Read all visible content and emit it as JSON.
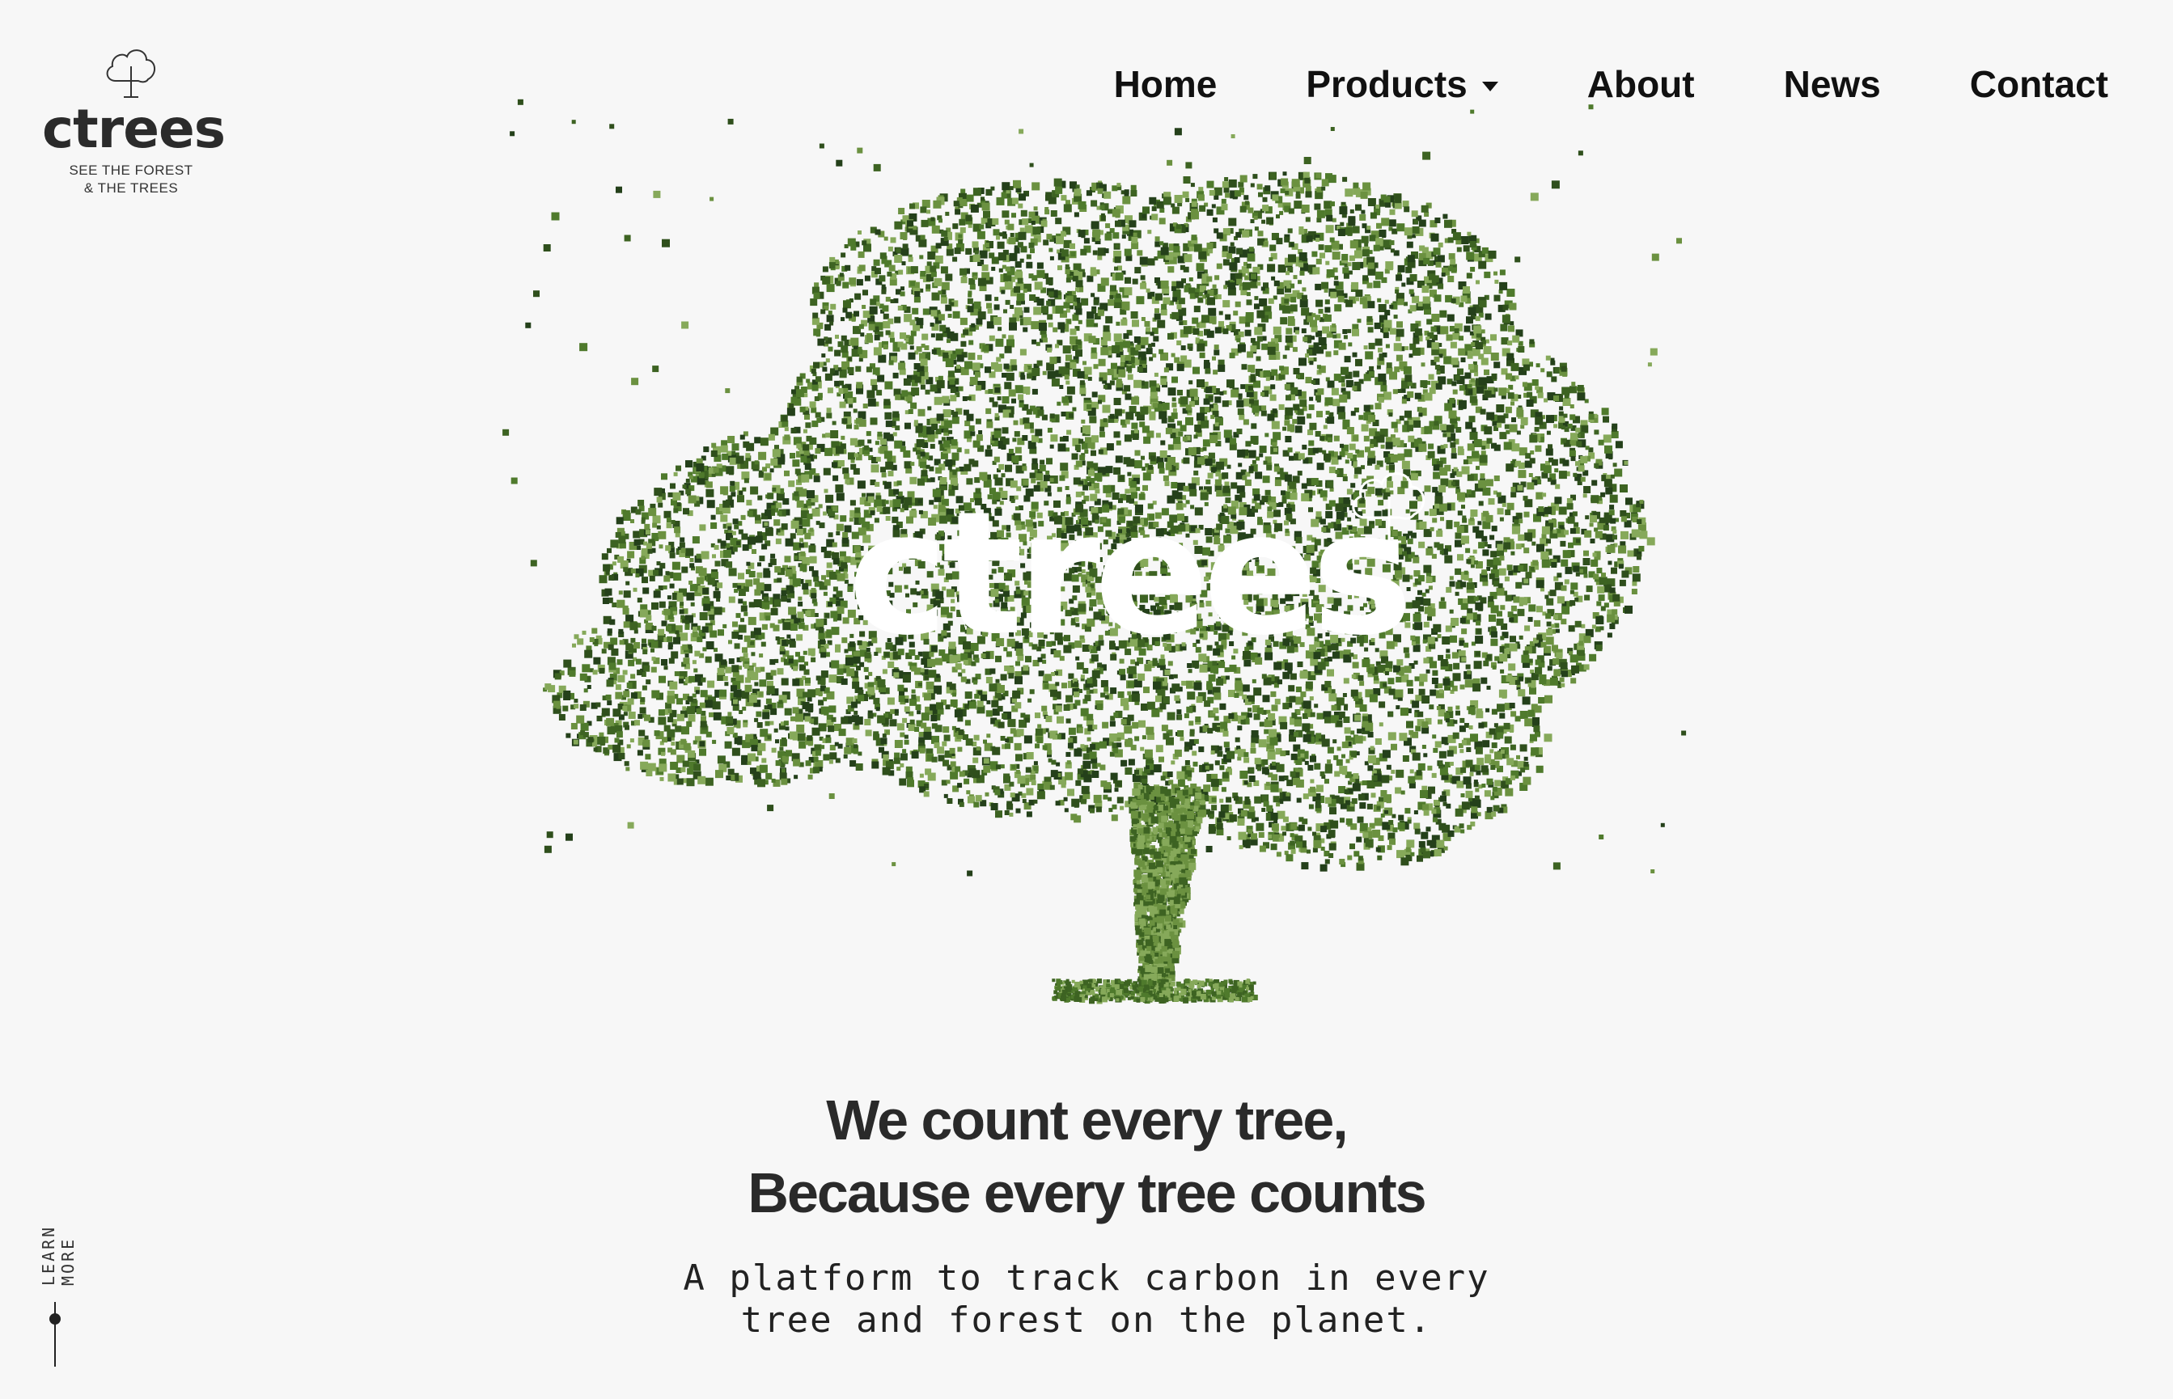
{
  "brand": {
    "logo_word": "ctrees",
    "tagline_line1": "SEE THE FOREST",
    "tagline_line2": "& THE TREES",
    "hero_word": "ctrees",
    "icon": "tree-cloud-icon"
  },
  "nav": {
    "items": [
      {
        "label": "Home"
      },
      {
        "label": "Products",
        "icon": "chevron-down-icon"
      },
      {
        "label": "About"
      },
      {
        "label": "News"
      },
      {
        "label": "Contact"
      }
    ]
  },
  "hero": {
    "headline_line1": "We count every tree,",
    "headline_line2": "Because every tree counts",
    "subline_line1": "A platform to track carbon in every",
    "subline_line2": "tree and forest on the planet."
  },
  "side": {
    "learn_more": "LEARN MORE"
  },
  "colors": {
    "background": "#f7f7f7",
    "text": "#222222",
    "tree_dark": "#2f4f1c",
    "tree_mid": "#4f7a2c",
    "tree_light": "#86a95a"
  }
}
